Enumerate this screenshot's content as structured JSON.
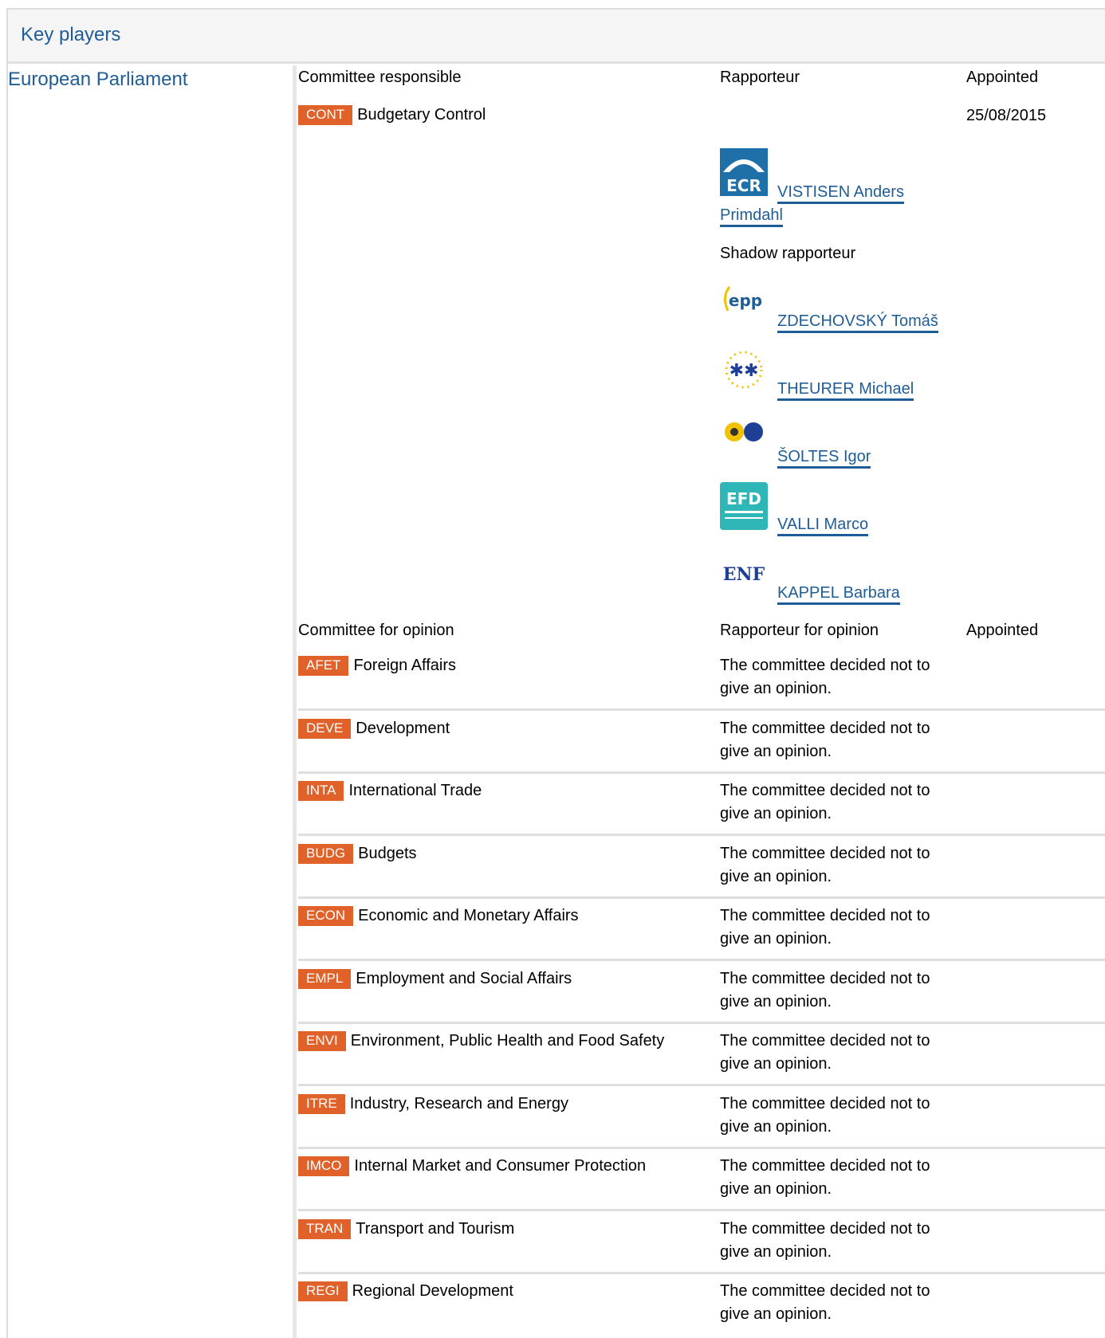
{
  "header": {
    "title": "Key players"
  },
  "institution": "European Parliament",
  "responsible": {
    "col_committee": "Committee responsible",
    "col_rapporteur": "Rapporteur",
    "col_appointed": "Appointed",
    "committee_code": "CONT",
    "committee_name": "Budgetary Control",
    "appointed": "25/08/2015",
    "rapporteur": {
      "name_line1": "VISTISEN Anders",
      "name_line2": "Primdahl",
      "group_logo": "ECR"
    },
    "shadow_label": "Shadow rapporteur",
    "shadows": [
      {
        "name": "ZDECHOVSKÝ Tomáš",
        "group_logo": "EPP"
      },
      {
        "name": "THEURER Michael",
        "group_logo": "ALDE"
      },
      {
        "name": "ŠOLTES Igor",
        "group_logo": "Greens/EFA"
      },
      {
        "name": "VALLI Marco",
        "group_logo": "EFDD"
      },
      {
        "name": "KAPPEL Barbara",
        "group_logo": "ENF"
      }
    ]
  },
  "opinion": {
    "col_committee": "Committee for opinion",
    "col_rapporteur": "Rapporteur for opinion",
    "col_appointed": "Appointed",
    "rows": [
      {
        "code": "AFET",
        "name": "Foreign Affairs",
        "note": "The committee decided not to give an opinion."
      },
      {
        "code": "DEVE",
        "name": "Development",
        "note": "The committee decided not to give an opinion."
      },
      {
        "code": "INTA",
        "name": "International Trade",
        "note": "The committee decided not to give an opinion."
      },
      {
        "code": "BUDG",
        "name": "Budgets",
        "note": "The committee decided not to give an opinion."
      },
      {
        "code": "ECON",
        "name": "Economic and Monetary Affairs",
        "note": "The committee decided not to give an opinion."
      },
      {
        "code": "EMPL",
        "name": "Employment and Social Affairs",
        "note": "The committee decided not to give an opinion."
      },
      {
        "code": "ENVI",
        "name": "Environment, Public Health and Food Safety",
        "note": "The committee decided not to give an opinion."
      },
      {
        "code": "ITRE",
        "name": "Industry, Research and Energy",
        "note": "The committee decided not to give an opinion."
      },
      {
        "code": "IMCO",
        "name": "Internal Market and Consumer Protection",
        "note": "The committee decided not to give an opinion."
      },
      {
        "code": "TRAN",
        "name": "Transport and Tourism",
        "note": "The committee decided not to give an opinion."
      },
      {
        "code": "REGI",
        "name": "Regional Development",
        "note": "The committee decided not to give an opinion."
      }
    ]
  },
  "colors": {
    "link": "#1f5d96",
    "badge": "#e0622a",
    "divider": "#dedede"
  }
}
